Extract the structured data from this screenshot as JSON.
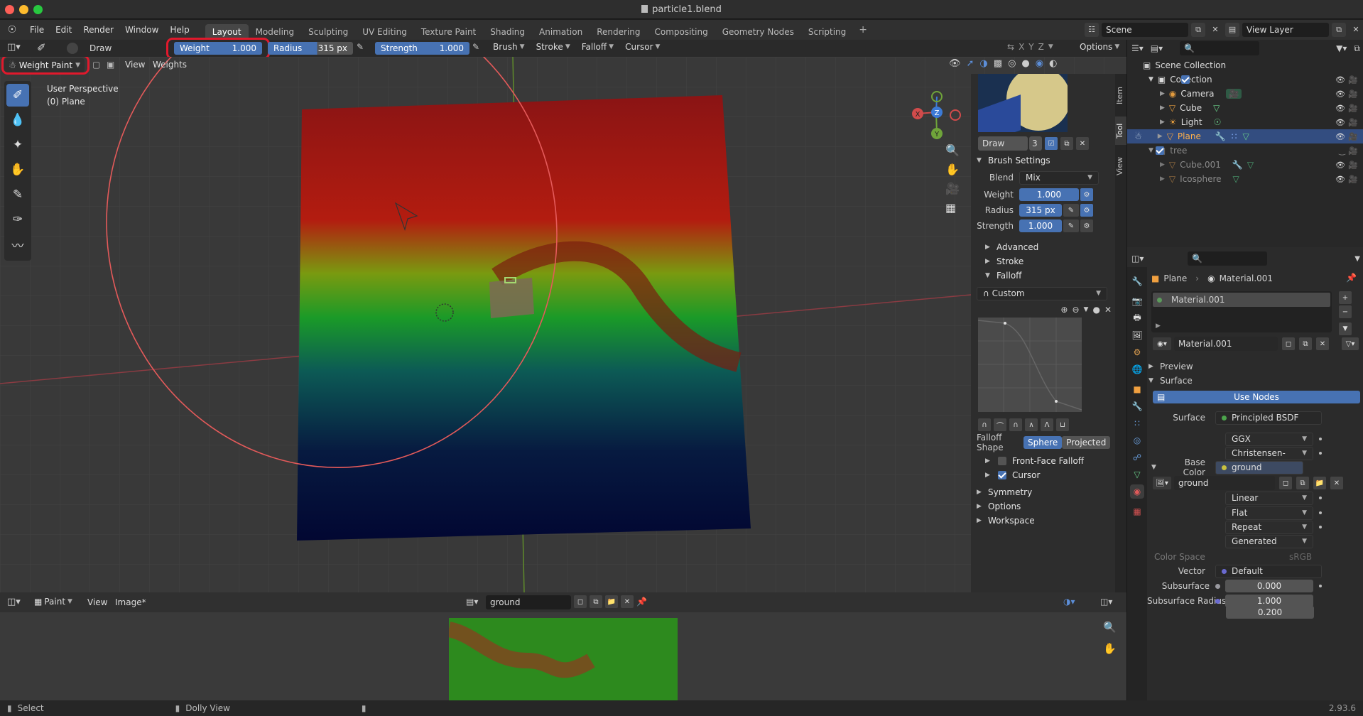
{
  "window": {
    "title": "particle1.blend"
  },
  "menu": [
    "File",
    "Edit",
    "Render",
    "Window",
    "Help"
  ],
  "workspaces": [
    "Layout",
    "Modeling",
    "Sculpting",
    "UV Editing",
    "Texture Paint",
    "Shading",
    "Animation",
    "Rendering",
    "Compositing",
    "Geometry Nodes",
    "Scripting"
  ],
  "active_workspace": "Layout",
  "scene": "Scene",
  "view_layer": "View Layer",
  "tool_header": {
    "brush": "Draw",
    "weight_label": "Weight",
    "weight_value": "1.000",
    "radius_label": "Radius",
    "radius_value": "315 px",
    "strength_label": "Strength",
    "strength_value": "1.000",
    "menus": [
      "Brush",
      "Stroke",
      "Falloff",
      "Cursor"
    ],
    "options": "Options",
    "axes": [
      "X",
      "Y",
      "Z"
    ]
  },
  "viewport_header": {
    "mode": "Weight Paint",
    "view": "View",
    "weights": "Weights"
  },
  "viewport_info": {
    "perspective": "User Perspective",
    "object": "(0) Plane"
  },
  "gizmo": {
    "x": "X",
    "y": "Y",
    "z": "Z"
  },
  "npanel": {
    "tabs": [
      "Item",
      "Tool",
      "View"
    ],
    "brush_name": "Draw",
    "brush_users": "3",
    "brush_settings": "Brush Settings",
    "blend_label": "Blend",
    "blend_value": "Mix",
    "weight_label": "Weight",
    "weight_value": "1.000",
    "radius_label": "Radius",
    "radius_value": "315 px",
    "strength_label": "Strength",
    "strength_value": "1.000",
    "advanced": "Advanced",
    "stroke": "Stroke",
    "falloff": "Falloff",
    "falloff_preset": "Custom",
    "falloff_shape_label": "Falloff Shape",
    "falloff_shape_options": [
      "Sphere",
      "Projected"
    ],
    "front_face_falloff": "Front-Face Falloff",
    "cursor": "Cursor",
    "symmetry": "Symmetry",
    "options": "Options",
    "workspace": "Workspace"
  },
  "image_editor": {
    "mode": "Paint",
    "view": "View",
    "image_menu": "Image*",
    "image_name": "ground"
  },
  "statusbar": {
    "left": "Select",
    "mid": "Dolly View",
    "version": "2.93.6"
  },
  "outliner": {
    "root": "Scene Collection",
    "items": [
      {
        "label": "Collection",
        "level": 1
      },
      {
        "label": "Camera",
        "level": 2
      },
      {
        "label": "Cube",
        "level": 2
      },
      {
        "label": "Light",
        "level": 2
      },
      {
        "label": "Plane",
        "level": 2
      },
      {
        "label": "tree",
        "level": 1
      },
      {
        "label": "Cube.001",
        "level": 2
      },
      {
        "label": "Icosphere",
        "level": 2
      }
    ]
  },
  "properties": {
    "breadcrumb_object": "Plane",
    "breadcrumb_material": "Material.001",
    "slot": "Material.001",
    "material_name": "Material.001",
    "preview": "Preview",
    "surface_section": "Surface",
    "use_nodes": "Use Nodes",
    "surface_label": "Surface",
    "surface_value": "Principled BSDF",
    "distribution": "GGX",
    "subsurface_method": "Christensen-Burley",
    "base_color_label": "Base Color",
    "base_color_value": "ground",
    "image_name": "ground",
    "interpolation": "Linear",
    "projection": "Flat",
    "extension": "Repeat",
    "source": "Generated",
    "color_space_label": "Color Space",
    "color_space_value": "sRGB",
    "vector_label": "Vector",
    "vector_value": "Default",
    "subsurface_label": "Subsurface",
    "subsurface_value": "0.000",
    "subsurface_radius_label": "Subsurface Radius",
    "subsurface_radius_1": "1.000",
    "subsurface_radius_2": "0.200"
  },
  "colors": {
    "accent": "#4772b3",
    "highlight_ring": "#e0192c",
    "selected_row": "#334d80"
  }
}
